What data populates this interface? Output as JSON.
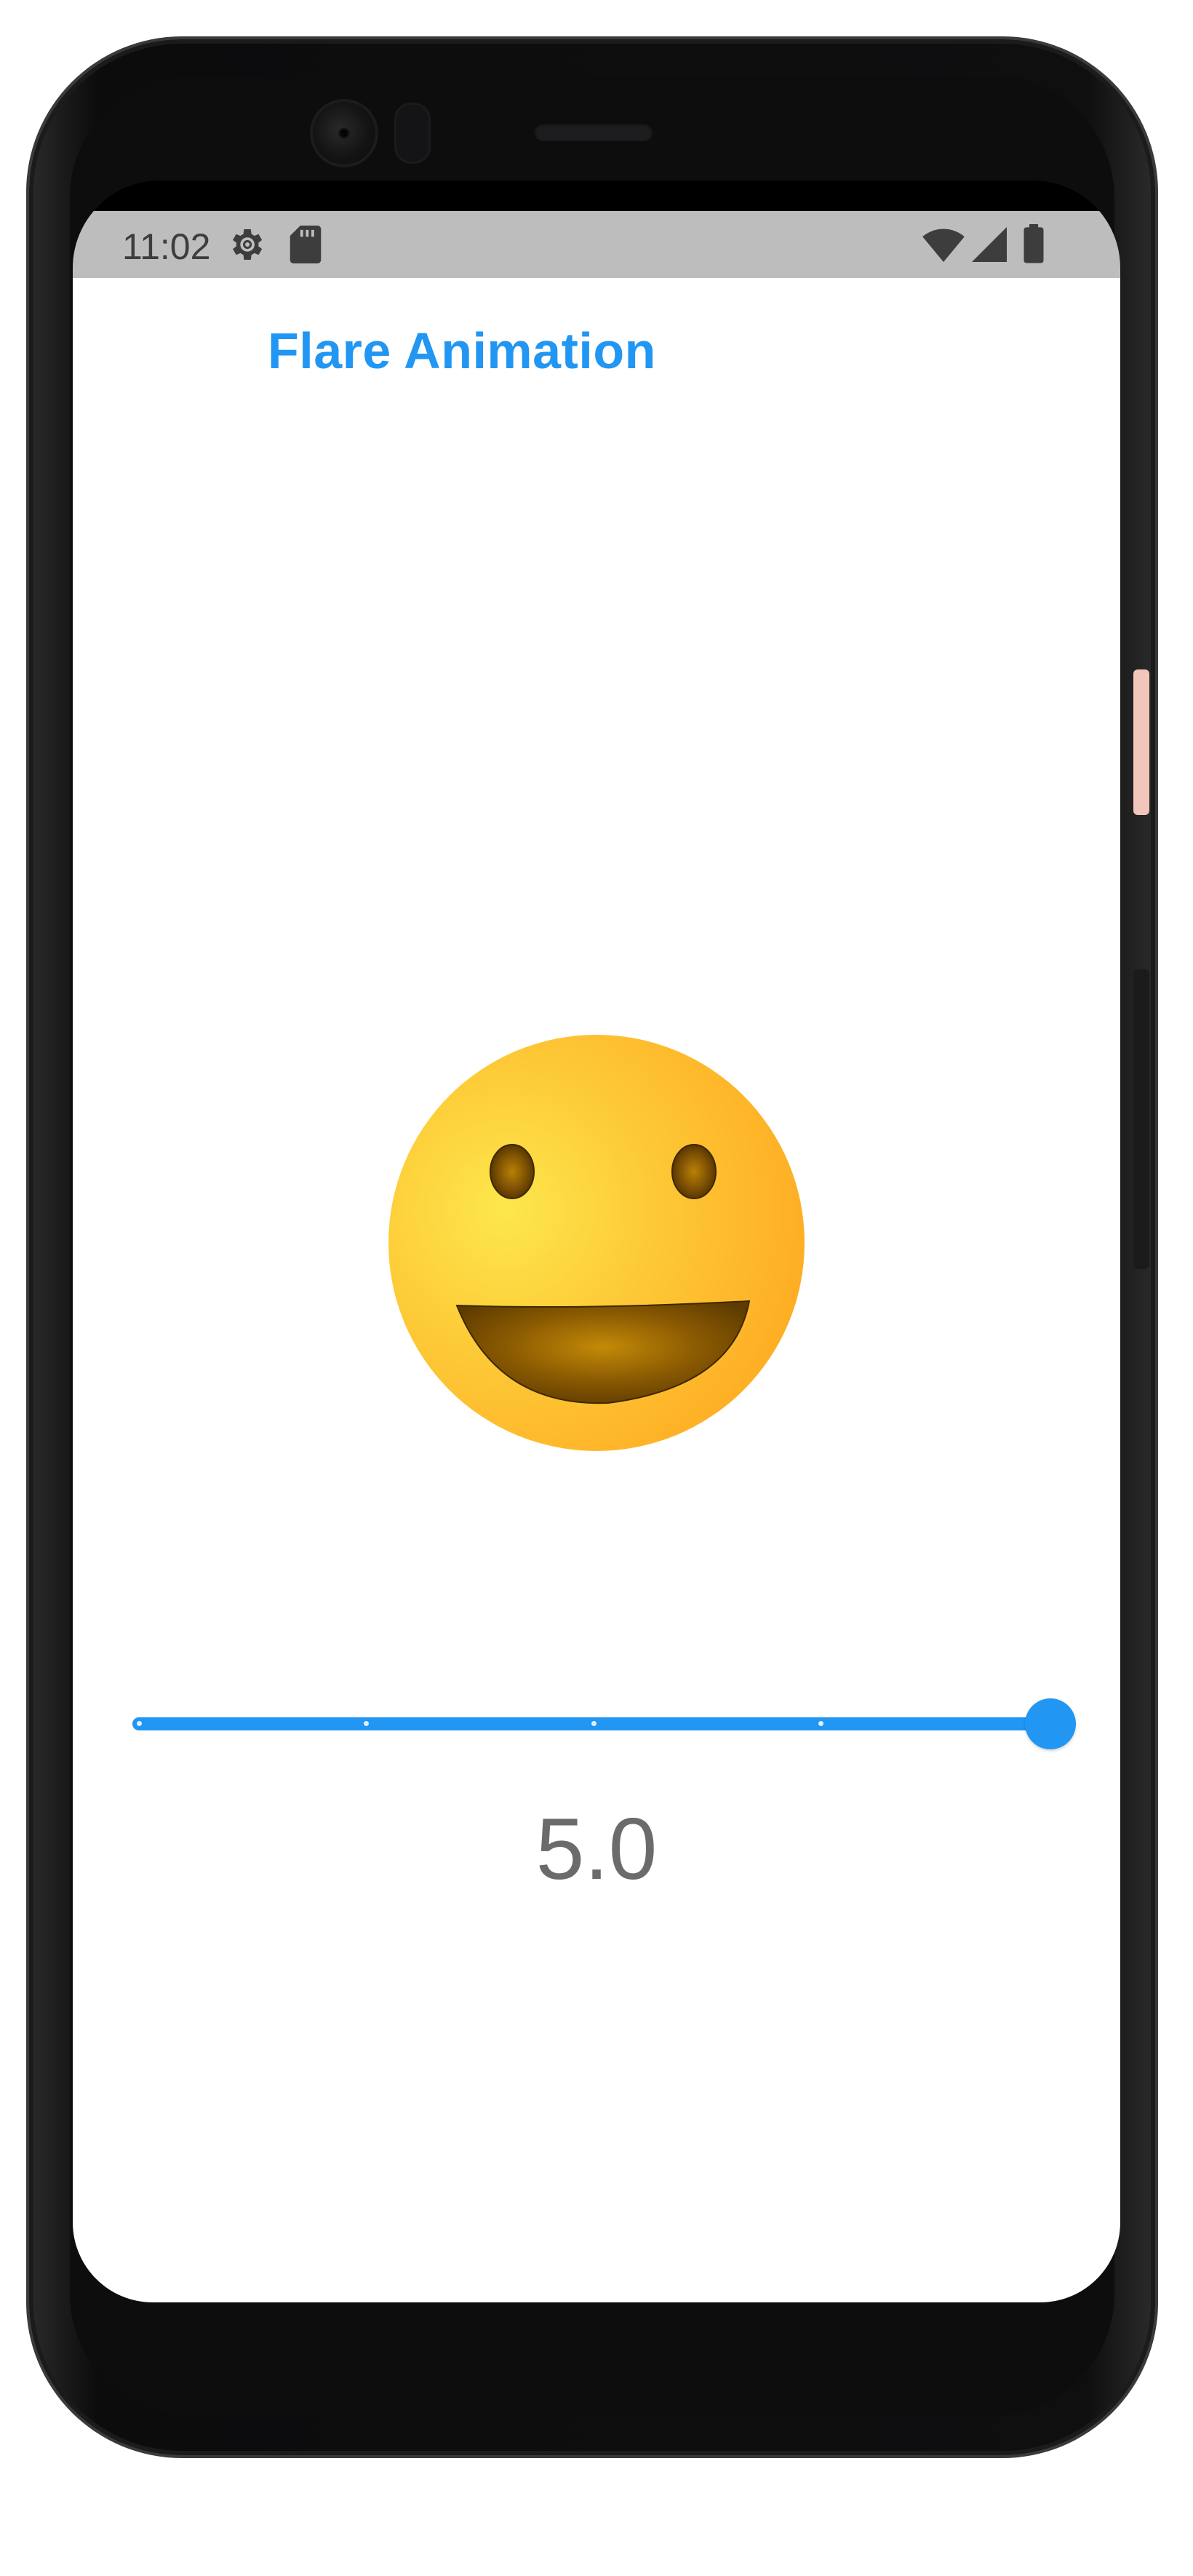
{
  "status_bar": {
    "time": "11:02",
    "left_icons": [
      "gear-icon",
      "sd-card-icon"
    ],
    "right_icons": [
      "wifi-icon",
      "cell-signal-icon",
      "battery-icon"
    ]
  },
  "app": {
    "title": "Flare Animation",
    "animation": {
      "icon": "smiley-face-icon"
    },
    "slider": {
      "min": 0,
      "max": 5,
      "divisions": 4,
      "value": 5.0,
      "value_label": "5.0"
    }
  },
  "colors": {
    "accent": "#2196f3",
    "status_bar_bg": "#bdbdbd",
    "value_text": "#6b6b6b",
    "smiley_yellow": "#fdd835",
    "smiley_orange": "#ffa726"
  }
}
